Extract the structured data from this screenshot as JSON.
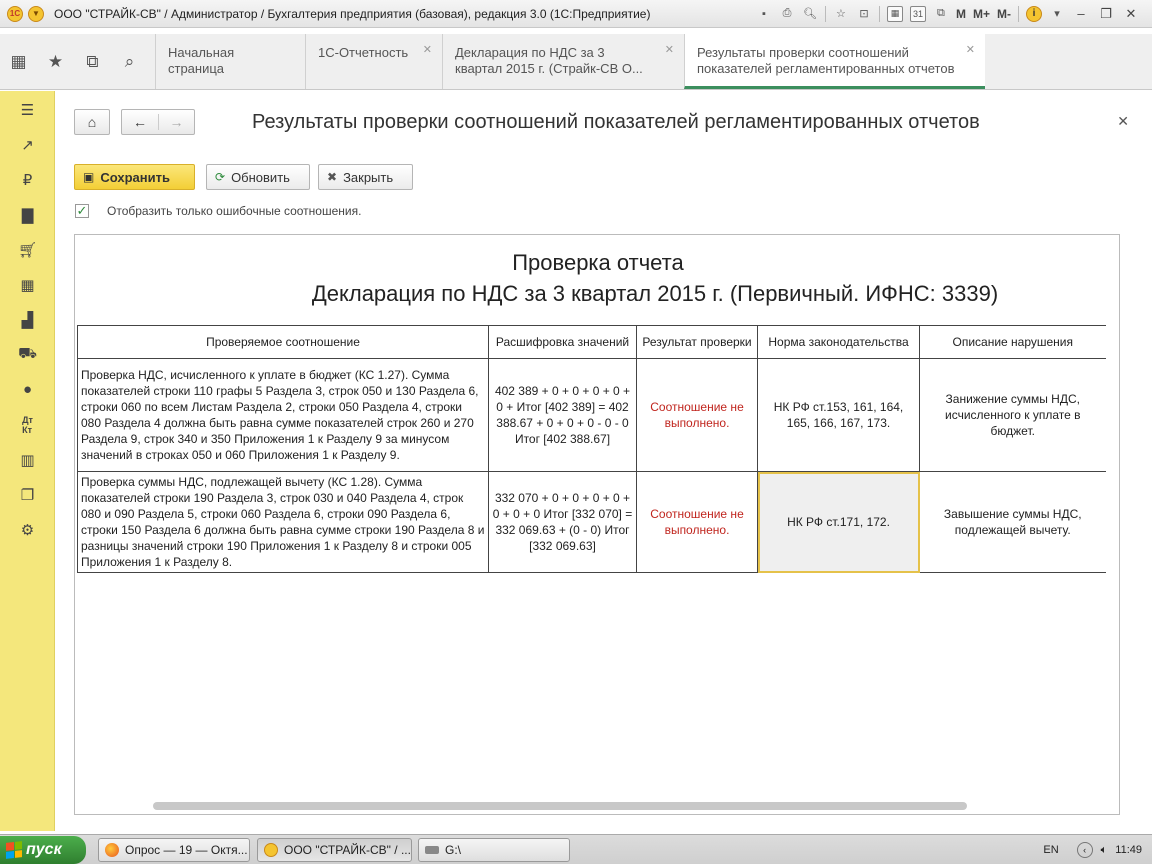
{
  "window": {
    "title": "ООО \"СТРАЙК-СВ\" / Администратор / Бухгалтерия предприятия (базовая), редакция 3.0 (1С:Предприятие)",
    "toolbar_labels": [
      "M",
      "M+",
      "M-"
    ]
  },
  "tabs": [
    {
      "label": "Начальная страница",
      "closable": false
    },
    {
      "label": "1С-Отчетность",
      "closable": true
    },
    {
      "label": "Декларация по НДС за 3 квартал 2015 г. (Страйк-СВ О...",
      "closable": true
    },
    {
      "label": "Результаты проверки соотношений показателей регламентированных отчетов",
      "closable": true,
      "active": true
    }
  ],
  "sidebar_icons": [
    "menu-icon",
    "chart-trend-icon",
    "ruble-icon",
    "bag-icon",
    "cart-icon",
    "warehouse-icon",
    "factory-icon",
    "truck-icon",
    "person-icon",
    "debit-credit-icon",
    "bar-chart-icon",
    "documents-icon",
    "gear-icon"
  ],
  "page": {
    "title": "Результаты проверки соотношений показателей регламентированных отчетов",
    "buttons": {
      "save": "Сохранить",
      "refresh": "Обновить",
      "close": "Закрыть"
    },
    "only_errors_label": "Отобразить только ошибочные соотношения.",
    "only_errors_checked": true
  },
  "report": {
    "heading": "Проверка отчета",
    "subheading": "Декларация по НДС за 3 квартал 2015 г. (Первичный. ИФНС: 3339)",
    "columns": [
      "Проверяемое соотношение",
      "Расшифровка значений",
      "Результат проверки",
      "Норма законодательства",
      "Описание нарушения"
    ],
    "rows": [
      {
        "relation": "Проверка НДС, исчисленного к уплате в бюджет (КС 1.27). Сумма показателей строки 110 графы 5 Раздела 3, строк 050 и 130 Раздела 6, строки 060 по всем Листам Раздела 2, строки 050 Раздела 4, строки 080 Раздела 4 должна быть равна сумме показателей строк 260 и 270 Раздела 9, строк 340 и 350 Приложения 1 к Разделу 9 за минусом значений в строках 050 и 060 Приложения 1 к Разделу 9.",
        "values": "402 389 + 0 + 0 + 0 + 0 + 0 + Итог [402 389] = 402 388.67 + 0 + 0 + 0 - 0 - 0 Итог [402 388.67]",
        "result": "Соотношение не выполнено.",
        "law": "НК РФ ст.153, 161, 164, 165, 166, 167, 173.",
        "violation": "Занижение суммы НДС, исчисленного к уплате в бюджет."
      },
      {
        "relation": "Проверка суммы НДС, подлежащей вычету (КС 1.28). Сумма показателей строки 190 Раздела 3, строк 030 и 040 Раздела 4, строк 080 и 090 Раздела 5, строки 060 Раздела 6, строки 090 Раздела 6, строки 150 Раздела 6 должна быть равна сумме строки 190 Раздела 8 и разницы значений строки 190 Приложения 1 к Разделу 8 и строки 005 Приложения 1 к Разделу 8.",
        "values": "332 070 + 0 + 0 + 0 + 0 + 0 + 0 + 0 Итог [332 070] = 332 069.63 + (0 - 0) Итог [332 069.63]",
        "result": "Соотношение не выполнено.",
        "law": "НК РФ ст.171, 172.",
        "violation": "Завышение суммы НДС, подлежащей вычету."
      }
    ]
  },
  "taskbar": {
    "start": "пуск",
    "tasks": [
      {
        "label": "Опрос — 19 — Октя..."
      },
      {
        "label": "ООО \"СТРАЙК-СВ\" / ..."
      },
      {
        "label": "G:\\"
      }
    ],
    "lang": "EN",
    "time": "11:49"
  }
}
